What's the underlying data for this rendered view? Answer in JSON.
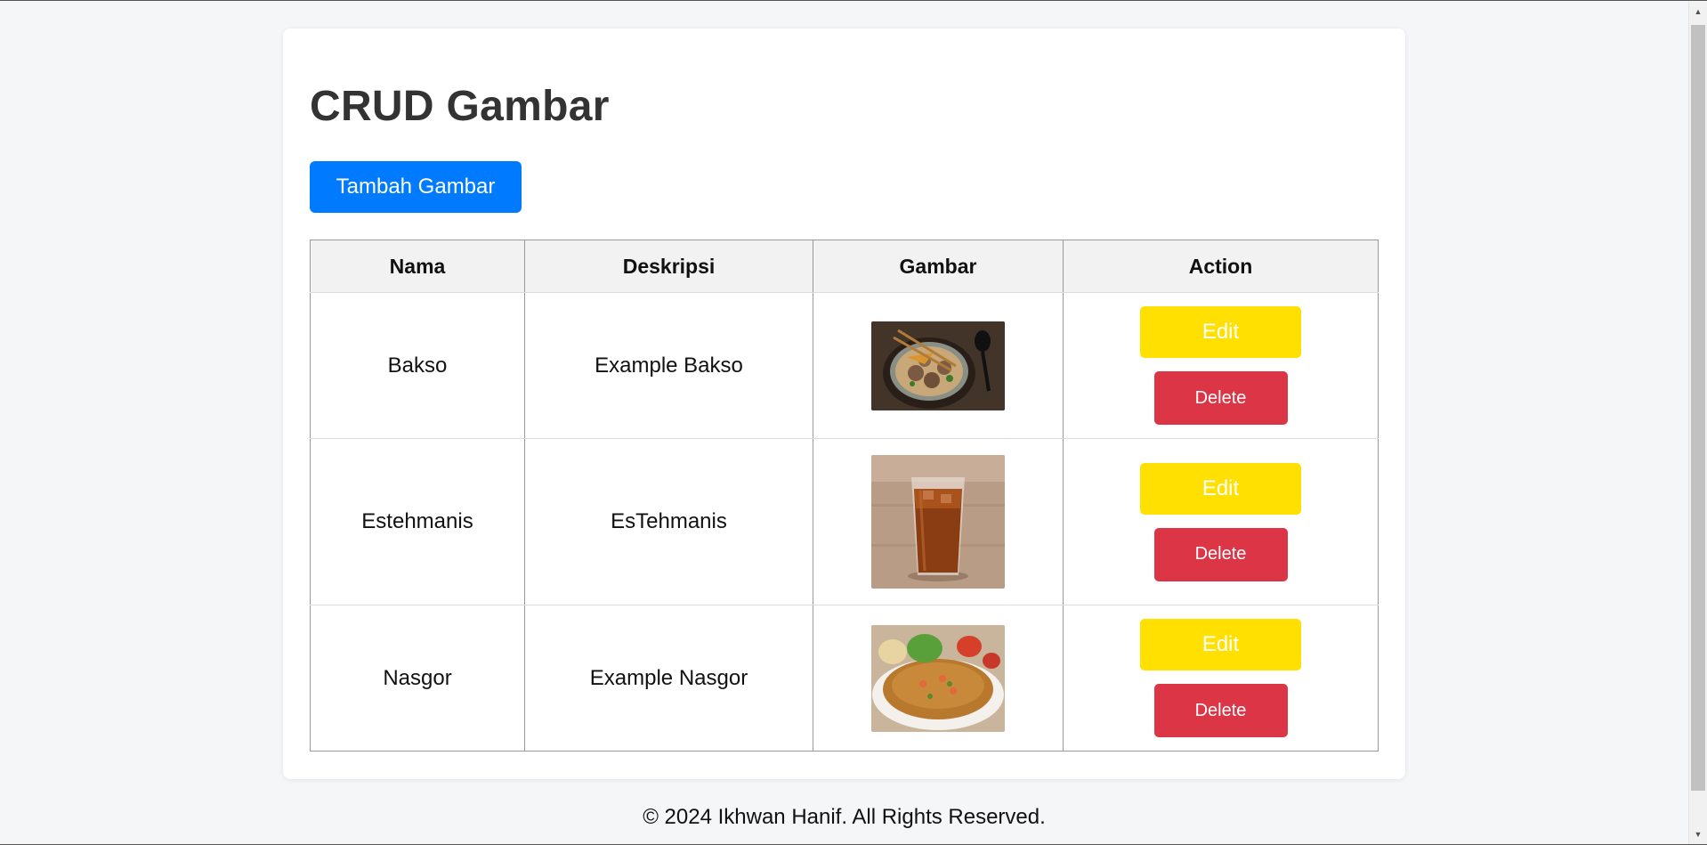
{
  "page": {
    "title": "CRUD Gambar",
    "add_button_label": "Tambah Gambar"
  },
  "table": {
    "headers": [
      "Nama",
      "Deskripsi",
      "Gambar",
      "Action"
    ],
    "rows": [
      {
        "nama": "Bakso",
        "deskripsi": "Example Bakso",
        "gambar": "bakso-photo",
        "edit_label": "Edit",
        "delete_label": "Delete"
      },
      {
        "nama": "Estehmanis",
        "deskripsi": "EsTehmanis",
        "gambar": "iced-tea-photo",
        "edit_label": "Edit",
        "delete_label": "Delete"
      },
      {
        "nama": "Nasgor",
        "deskripsi": "Example Nasgor",
        "gambar": "fried-rice-photo",
        "edit_label": "Edit",
        "delete_label": "Delete"
      }
    ]
  },
  "footer": {
    "text": "© 2024 Ikhwan Hanif. All Rights Reserved."
  },
  "colors": {
    "primary": "#007bff",
    "edit": "#ffe000",
    "delete": "#dc3545",
    "background": "#f4f6f8"
  }
}
